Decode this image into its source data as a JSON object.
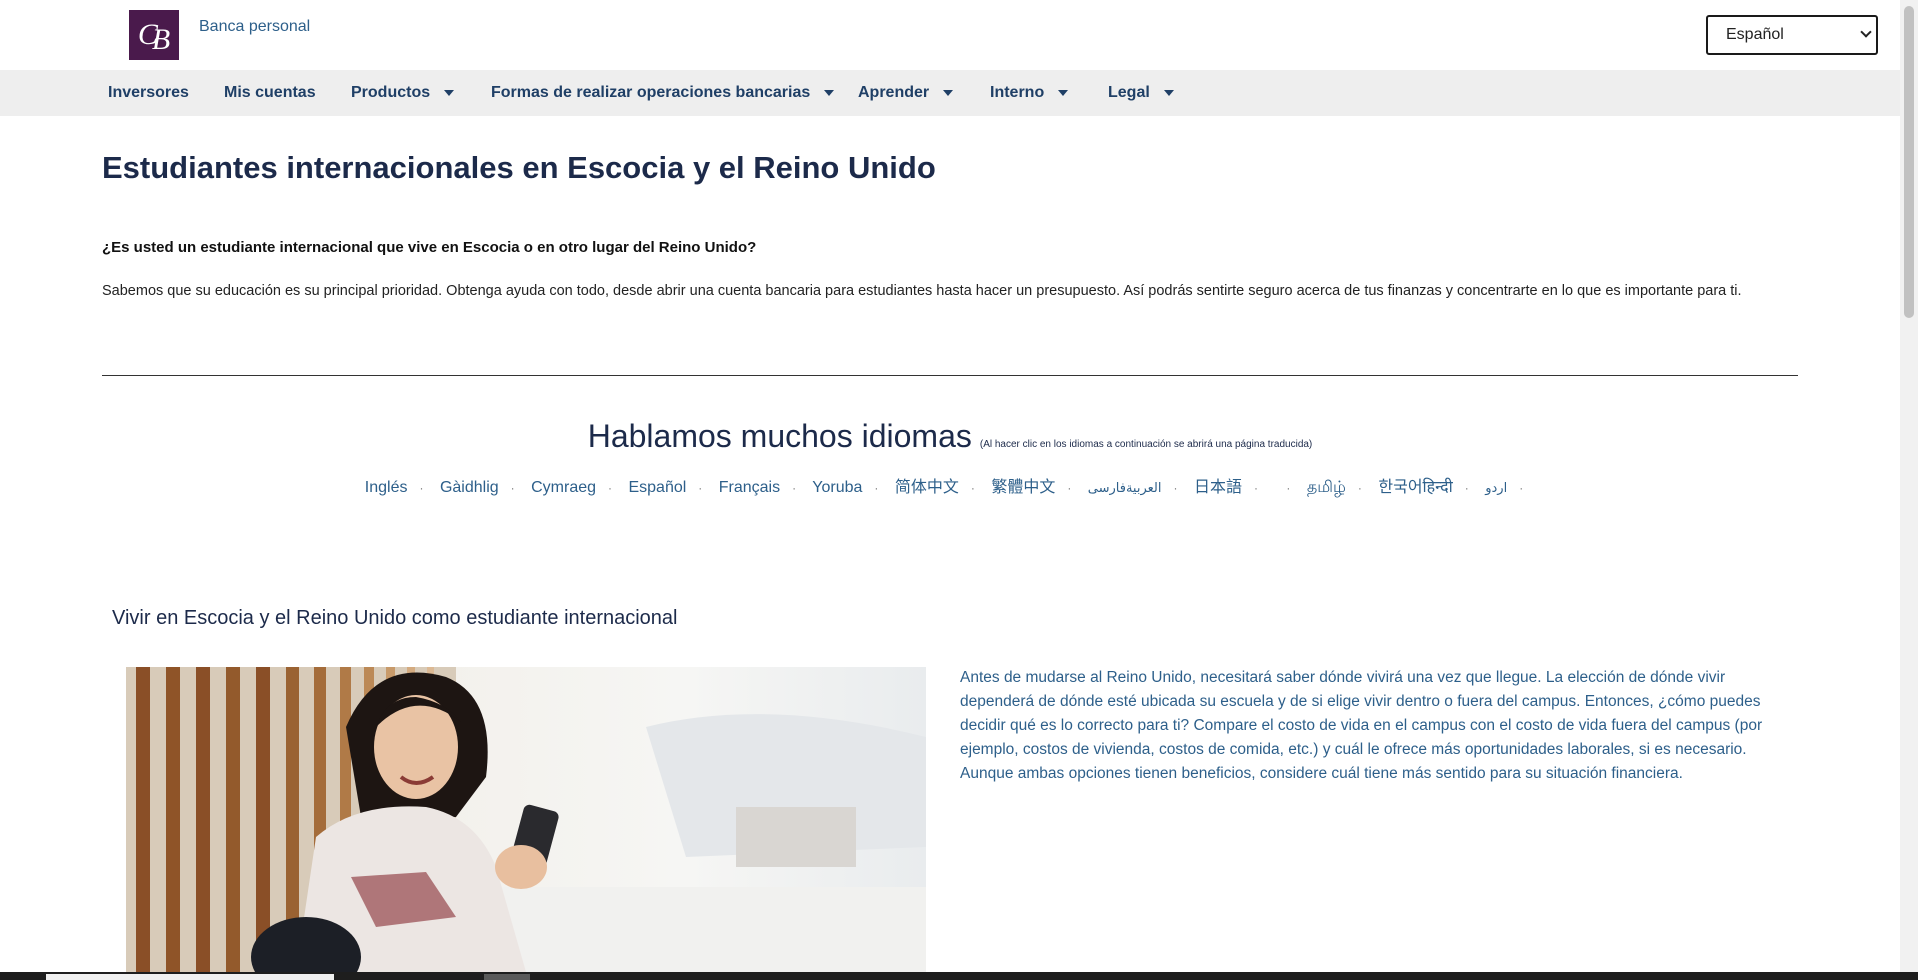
{
  "header": {
    "brand_label": "Banca personal",
    "language_select": {
      "selected": "Español"
    }
  },
  "nav": {
    "items": [
      {
        "label": "Inversores",
        "dropdown": false
      },
      {
        "label": "Mis cuentas",
        "dropdown": false
      },
      {
        "label": "Productos",
        "dropdown": true
      },
      {
        "label": "Formas de realizar operaciones bancarias",
        "dropdown": true
      },
      {
        "label": "Aprender",
        "dropdown": true
      },
      {
        "label": "Interno",
        "dropdown": true
      },
      {
        "label": "Legal",
        "dropdown": true
      }
    ]
  },
  "main": {
    "title": "Estudiantes internacionales en Escocia y el Reino Unido",
    "intro_question": "¿Es usted un estudiante internacional que vive en Escocia o en otro lugar del Reino Unido?",
    "intro_text": "Sabemos que su educación es su principal prioridad. Obtenga ayuda con todo, desde abrir una cuenta bancaria para estudiantes hasta hacer un presupuesto. Así podrás sentirte seguro acerca de tus finanzas y concentrarte en lo que es importante para ti.",
    "languages": {
      "heading": "Hablamos muchos idiomas",
      "note": "(Al hacer clic en los idiomas a continuación se abrirá una página traducida)",
      "items": [
        "Inglés",
        "Gàidhlig",
        "Cymraeg",
        "Español",
        "Français",
        "Yoruba",
        "简体中文",
        "繁體中文",
        "العربيةفارسی",
        "日本語",
        "",
        "தமிழ்",
        "한국어हिन्दी",
        "اردو"
      ]
    },
    "section": {
      "heading": "Vivir en Escocia y el Reino Unido como estudiante internacional",
      "text": "Antes de mudarse al Reino Unido, necesitará saber dónde vivirá una vez que llegue. La elección de dónde vivir dependerá de dónde esté ubicada su escuela y de si elige vivir dentro o fuera del campus. Entonces, ¿cómo puedes decidir qué es lo correcto para ti? Compare el costo de vida en el campus con el costo de vida fuera del campus (por ejemplo, costos de vivienda, costos de comida, etc.) y cuál le ofrece más oportunidades laborales, si es necesario. Aunque ambas opciones tienen beneficios, considere cuál tiene más sentido para su situación financiera."
    }
  },
  "colors": {
    "logo_bg": "#4a1a4c",
    "nav_bg": "#eeeeee",
    "heading": "#1c2a4a",
    "link": "#2d5f8a"
  }
}
